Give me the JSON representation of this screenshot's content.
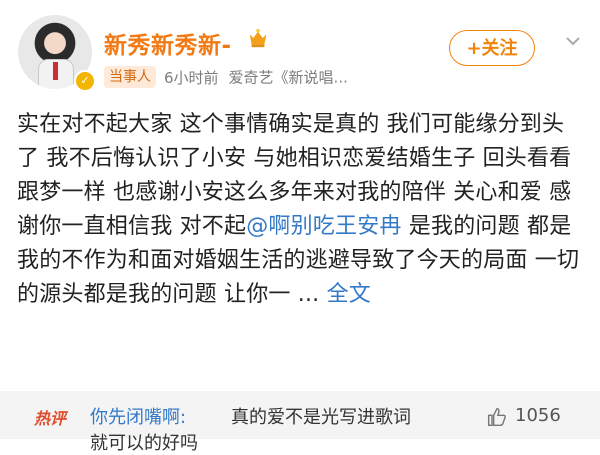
{
  "post": {
    "username": "新秀新秀新-",
    "follow_label": "+关注",
    "badge_label": "当事人",
    "time": "6小时前",
    "source": "爱奇艺《新说唱...",
    "content_before_mention": "实在对不起大家 这个事情确实是真的 我们可能缘分到头了 我不后悔认识了小安 与她相识恋爱结婚生子 回头看看 跟梦一样 也感谢小安这么多年来对我的陪伴 关心和爱 感谢你一直相信我 对不起",
    "mention": "@啊别吃王安冉",
    "content_after_mention": " 是我的问题 都是我的不作为和面对婚姻生活的逃避导致了今天的局面 一切的源头都是我的问题 让你一 ... ",
    "more_label": "全文"
  },
  "hot_comment": {
    "tag": "热评",
    "user": "你先闭嘴啊:",
    "text": "真的爱不是光写进歌词",
    "text_second_line": "就可以的好吗",
    "like_count": "1056"
  },
  "colors": {
    "username": "#f37a13",
    "link": "#3479c8",
    "hot_tag": "#e14d2a",
    "follow": "#f0840b"
  },
  "icons": [
    "verified-icon",
    "crown-icon",
    "chevron-down-icon",
    "thumbs-up-icon"
  ]
}
